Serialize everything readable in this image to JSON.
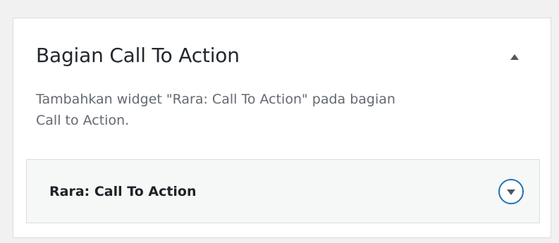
{
  "section": {
    "title": "Bagian Call To Action",
    "description_line1": "Tambahkan widget \"Rara: Call To Action\" pada bagian",
    "description_line2": "Call to Action.",
    "collapse_icon": "triangle-up-icon"
  },
  "widget": {
    "title": "Rara: Call To Action",
    "toggle_icon": "chevron-down-circle-icon"
  },
  "colors": {
    "background": "#f1f1f1",
    "panel": "#ffffff",
    "widget_background": "#f6f7f7",
    "border": "#dcdcde",
    "accent": "#2271b1",
    "muted_text": "#646970"
  }
}
